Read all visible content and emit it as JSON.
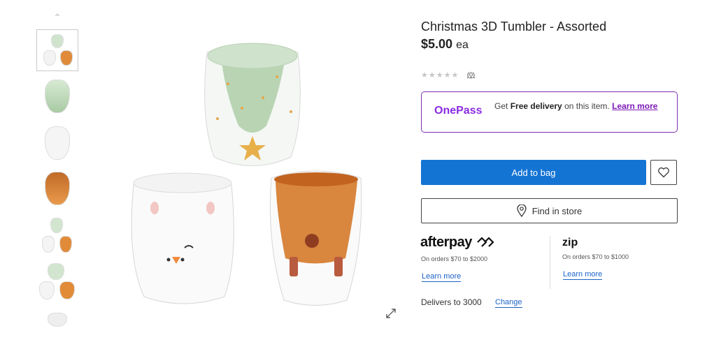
{
  "product": {
    "title": "Christmas 3D Tumbler - Assorted",
    "price": "$5.00",
    "price_unit": "ea",
    "rating_stars": "★★★★★",
    "review_count": "(0)"
  },
  "onepass": {
    "logo": "OnePass",
    "text_prefix": "Get ",
    "text_bold": "Free delivery",
    "text_suffix": " on this item. ",
    "learn_more": "Learn more"
  },
  "actions": {
    "add_to_bag": "Add to bag",
    "find_in_store": "Find in store"
  },
  "afterpay": {
    "logo": "afterpay",
    "note": "On orders $70 to $2000",
    "learn_more": "Learn more"
  },
  "zip": {
    "logo": "zip",
    "note": "On orders $70 to $1000",
    "learn_more": "Learn more"
  },
  "delivery": {
    "text": "Delivers to 3000",
    "change": "Change"
  },
  "gallery": {
    "active_thumbnail": 1,
    "thumbnails": [
      "thumbnail-set",
      "thumbnail-green-tree",
      "thumbnail-white-bunny",
      "thumbnail-orange-reindeer",
      "thumbnail-set-2",
      "thumbnail-set-3",
      "thumbnail-7"
    ]
  },
  "colors": {
    "primary_blue": "#1474d4",
    "onepass_purple": "#7c2fb0",
    "link_blue": "#1b63c6"
  }
}
